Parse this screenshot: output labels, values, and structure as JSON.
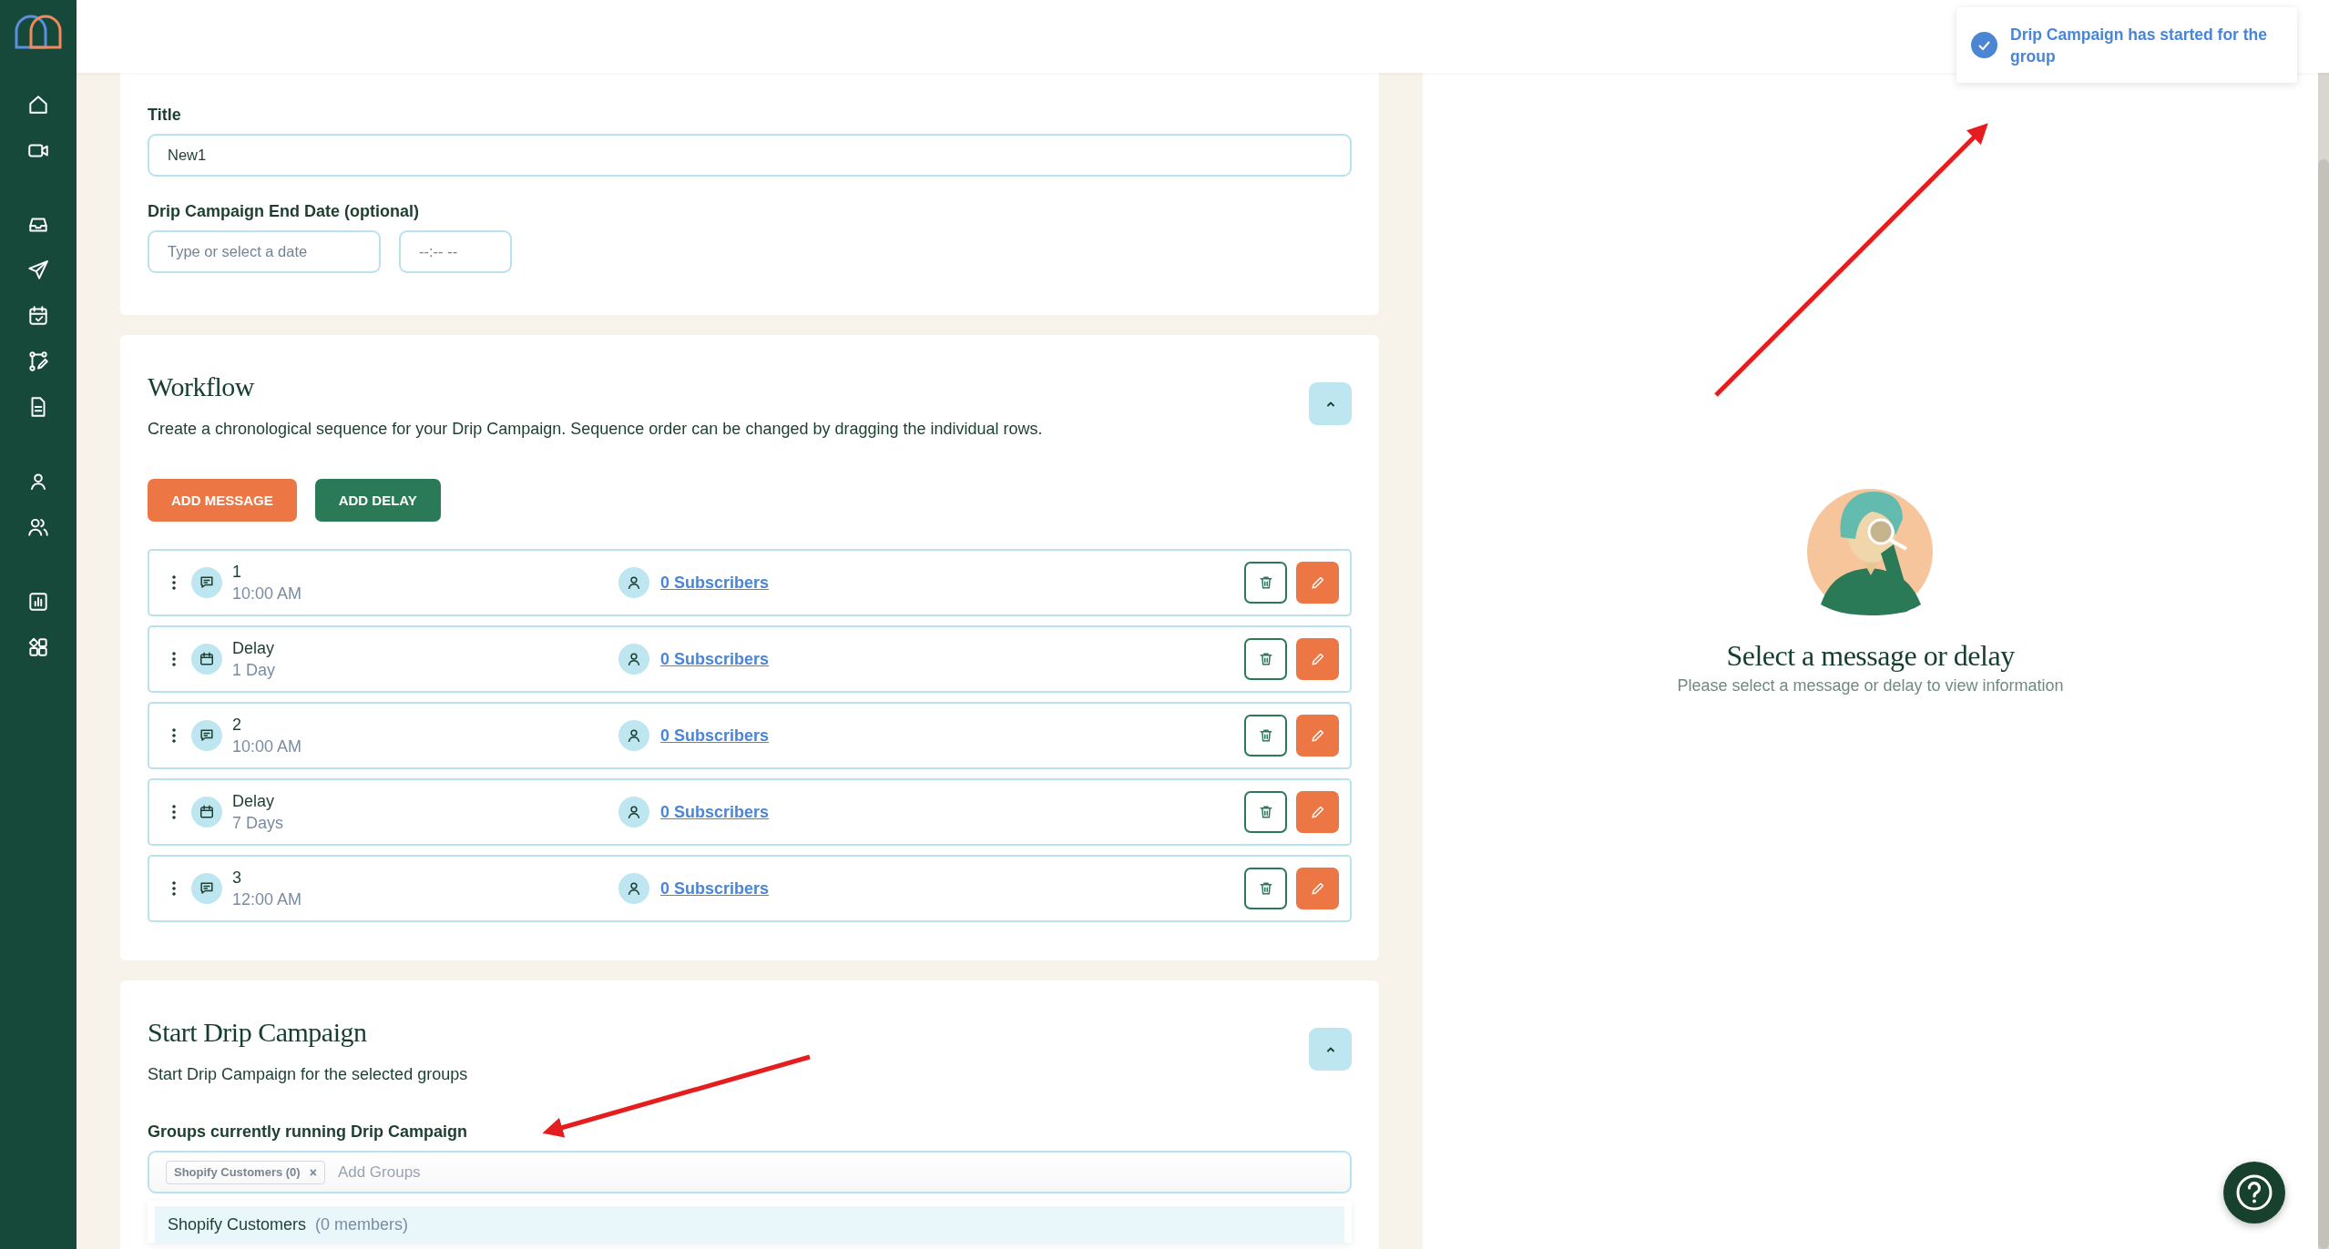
{
  "toast": {
    "message": "Drip Campaign has started for the group"
  },
  "details_form": {
    "title_label": "Title",
    "title_value": "New1",
    "end_date_label": "Drip Campaign End Date (optional)",
    "date_placeholder": "Type or select a date",
    "time_placeholder": "--:-- --"
  },
  "workflow": {
    "heading": "Workflow",
    "expanded": true,
    "description": "Create a chronological sequence for your Drip Campaign. Sequence order can be changed by dragging the individual rows.",
    "buttons": [
      {
        "label": "ADD MESSAGE",
        "kind": "primary"
      },
      {
        "label": "ADD DELAY",
        "kind": "secondary"
      }
    ],
    "steps": [
      {
        "kind": "message",
        "title": "1",
        "subtitle": "10:00 AM",
        "subscribers": "0 Subscribers"
      },
      {
        "kind": "delay",
        "title": "Delay",
        "subtitle": "1 Day",
        "subscribers": "0 Subscribers"
      },
      {
        "kind": "message",
        "title": "2",
        "subtitle": "10:00 AM",
        "subscribers": "0 Subscribers"
      },
      {
        "kind": "delay",
        "title": "Delay",
        "subtitle": "7 Days",
        "subscribers": "0 Subscribers"
      },
      {
        "kind": "message",
        "title": "3",
        "subtitle": "12:00 AM",
        "subscribers": "0 Subscribers"
      }
    ]
  },
  "start_campaign": {
    "heading": "Start Drip Campaign",
    "expanded": true,
    "description": "Start Drip Campaign for the selected groups",
    "groups_label": "Groups currently running Drip Campaign",
    "tags": [
      {
        "label": "Shopify Customers (0)",
        "remove": "×"
      }
    ],
    "placeholder": "Add Groups",
    "options": [
      {
        "name": "Shopify Customers",
        "count": "(0 members)",
        "selected": true
      }
    ]
  },
  "detail_pane": {
    "title": "Select a message or delay",
    "subtitle": "Please select a message or delay to view information"
  }
}
